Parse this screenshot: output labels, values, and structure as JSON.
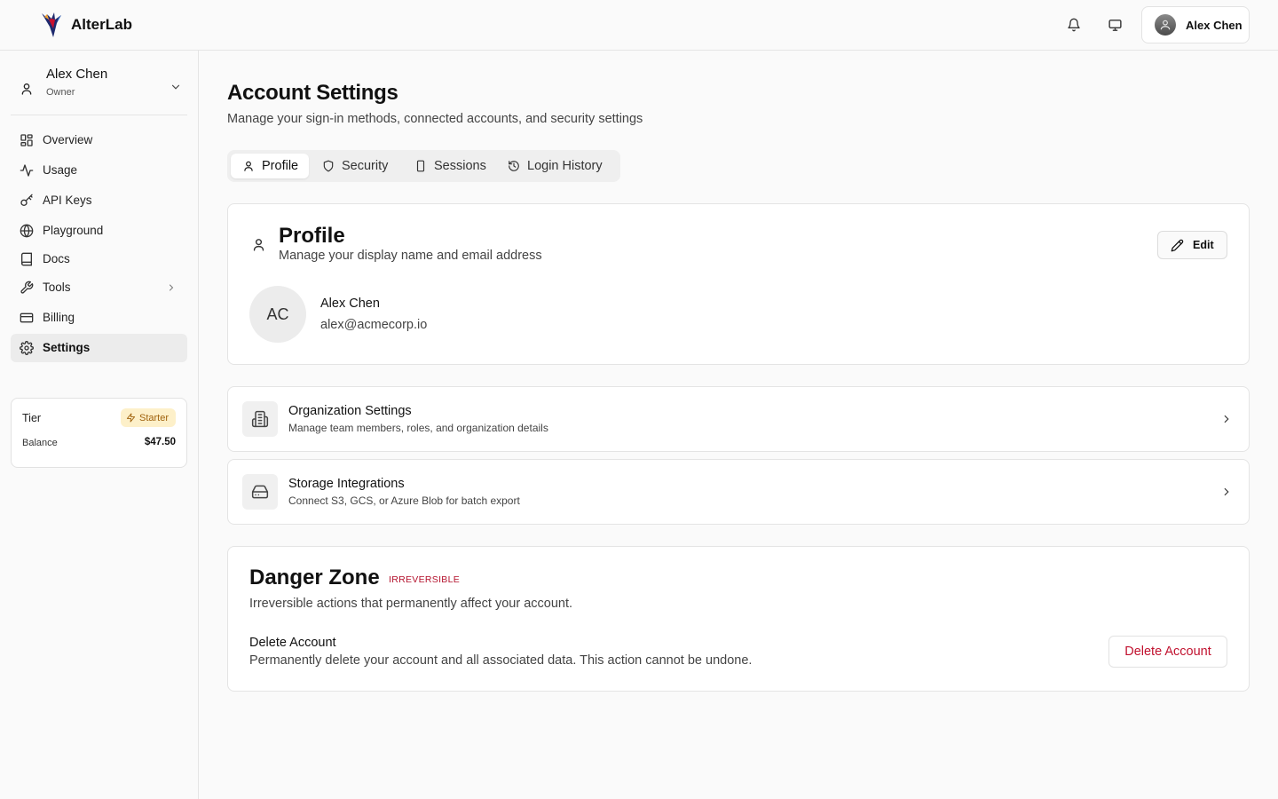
{
  "header": {
    "brand": "AlterLab",
    "user_name": "Alex Chen",
    "icons": [
      "bell-icon",
      "monitor-icon",
      "avatar"
    ]
  },
  "sidebar": {
    "org": {
      "name": "Alex Chen",
      "role": "Owner"
    },
    "items": [
      {
        "label": "Overview",
        "icon": "grid-icon"
      },
      {
        "label": "Usage",
        "icon": "activity-icon"
      },
      {
        "label": "API Keys",
        "icon": "key-icon"
      },
      {
        "label": "Playground",
        "icon": "globe-icon"
      },
      {
        "label": "Docs",
        "icon": "book-icon"
      },
      {
        "label": "Tools",
        "icon": "wrench-icon"
      },
      {
        "label": "Billing",
        "icon": "credit-card-icon"
      },
      {
        "label": "Settings",
        "icon": "gear-icon",
        "active": true
      }
    ],
    "tier": {
      "label": "Tier",
      "badge": "Starter",
      "balance_label": "Balance",
      "balance_value": "$47.50"
    }
  },
  "main": {
    "title": "Account Settings",
    "subtitle": "Manage your sign-in methods, connected accounts, and security settings",
    "tabs": [
      {
        "label": "Profile",
        "active": true
      },
      {
        "label": "Security"
      },
      {
        "label": "Sessions"
      },
      {
        "label": "Login History"
      }
    ],
    "profile": {
      "title": "Profile",
      "subtitle": "Manage your display name and email address",
      "edit_label": "Edit",
      "initials": "AC",
      "name": "Alex Chen",
      "email": "alex@acmecorp.io"
    },
    "links": [
      {
        "title": "Organization Settings",
        "subtitle": "Manage team members, roles, and organization details",
        "icon": "building-icon"
      },
      {
        "title": "Storage Integrations",
        "subtitle": "Connect S3, GCS, or Azure Blob for batch export",
        "icon": "hard-drive-icon"
      }
    ],
    "danger": {
      "title": "Danger Zone",
      "badge": "IRREVERSIBLE",
      "subtitle": "Irreversible actions that permanently affect your account.",
      "action_title": "Delete Account",
      "action_desc": "Permanently delete your account and all associated data. This action cannot be undone.",
      "button_label": "Delete Account"
    }
  },
  "colors": {
    "accent_danger": "#c1122f",
    "tier_badge_bg": "#fdf0c9",
    "tier_badge_fg": "#a0620d"
  }
}
